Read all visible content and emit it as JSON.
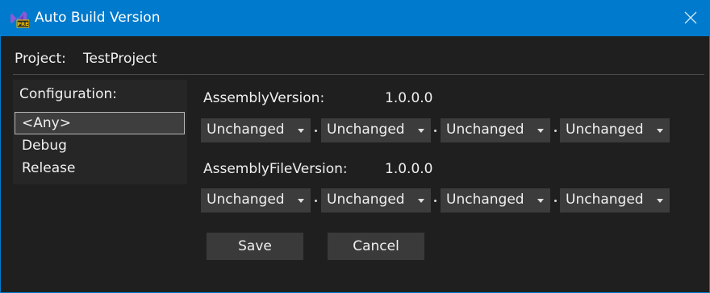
{
  "window": {
    "title": "Auto Build Version",
    "accent_color": "#007acc",
    "icon": "vs-preview-icon",
    "icon_badge": "PRE"
  },
  "project": {
    "label": "Project:",
    "value": "TestProject"
  },
  "configuration": {
    "label": "Configuration:",
    "items": [
      "<Any>",
      "Debug",
      "Release"
    ],
    "selected": "<Any>"
  },
  "assembly_version": {
    "label": "AssemblyVersion:",
    "value": "1.0.0.0",
    "parts": [
      "Unchanged",
      "Unchanged",
      "Unchanged",
      "Unchanged"
    ]
  },
  "assembly_file_version": {
    "label": "AssemblyFileVersion:",
    "value": "1.0.0.0",
    "parts": [
      "Unchanged",
      "Unchanged",
      "Unchanged",
      "Unchanged"
    ]
  },
  "buttons": {
    "save": "Save",
    "cancel": "Cancel"
  }
}
